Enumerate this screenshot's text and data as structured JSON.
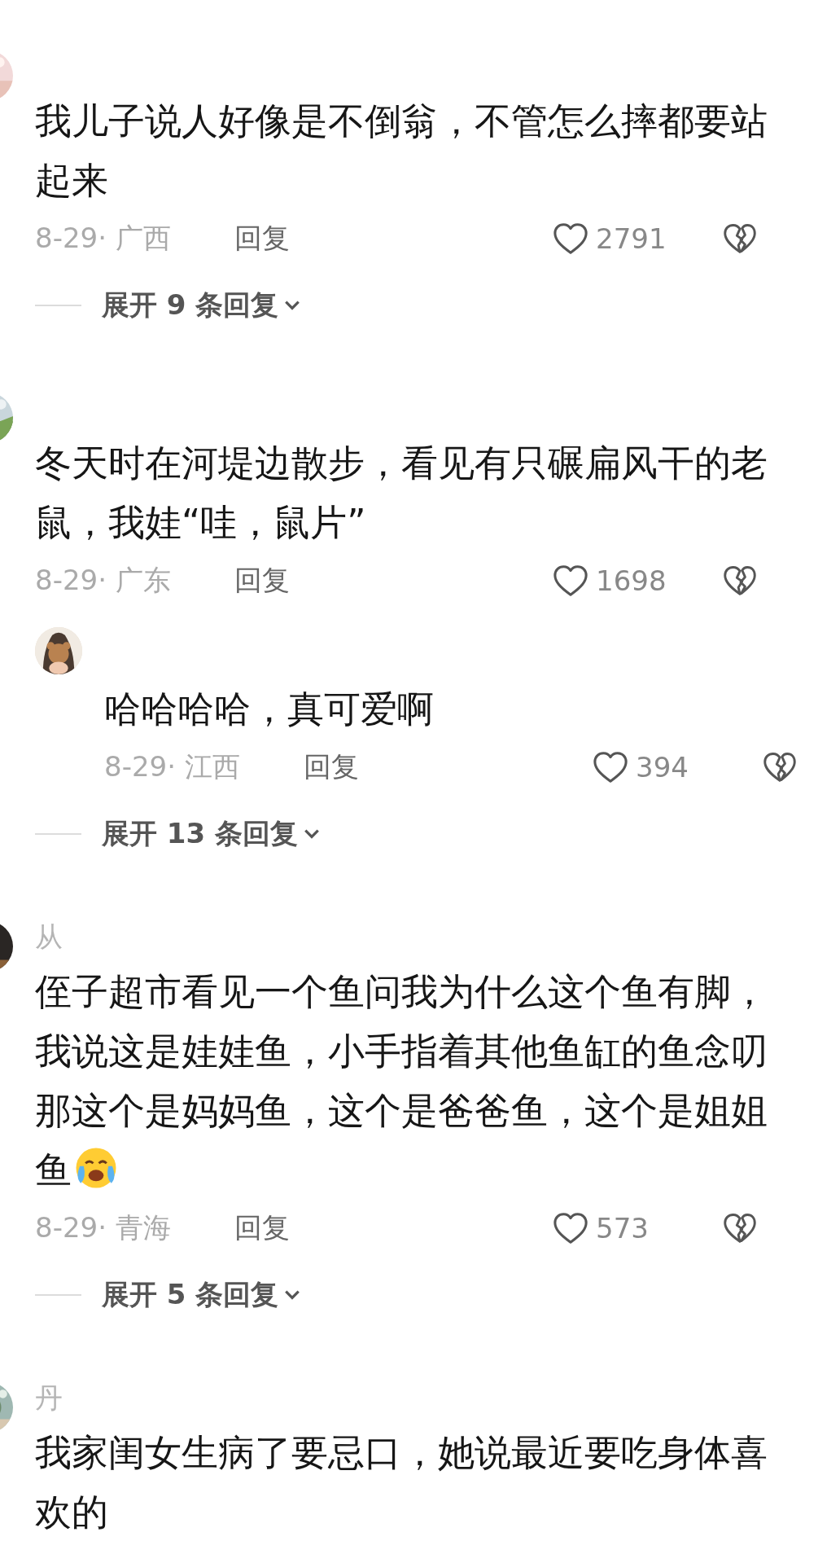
{
  "comments": [
    {
      "text": "我儿子说人好像是不倒翁，不管怎么摔都要站起来",
      "date": "8-29· 广西",
      "reply_label": "回复",
      "likes": "2791",
      "expand": "展开 9 条回复"
    },
    {
      "text": "冬天时在河堤边散步，看见有只碾扁风干的老鼠，我娃“哇，鼠片”",
      "date": "8-29· 广东",
      "reply_label": "回复",
      "likes": "1698",
      "replies": [
        {
          "text": "哈哈哈哈，真可爱啊",
          "date": "8-29· 江西",
          "reply_label": "回复",
          "likes": "394"
        }
      ],
      "expand": "展开 13 条回复"
    },
    {
      "name": "从",
      "text": "侄子超市看见一个鱼问我为什么这个鱼有脚，我说这是娃娃鱼，小手指着其他鱼缸的鱼念叨那这个是妈妈鱼，这个是爸爸鱼，这个是姐姐鱼",
      "trailing_emoji": true,
      "date": "8-29· 青海",
      "reply_label": "回复",
      "likes": "573",
      "expand": "展开 5 条回复"
    },
    {
      "name": "丹",
      "text": "我家闺女生病了要忌口，她说最近要吃身体喜欢的"
    }
  ]
}
